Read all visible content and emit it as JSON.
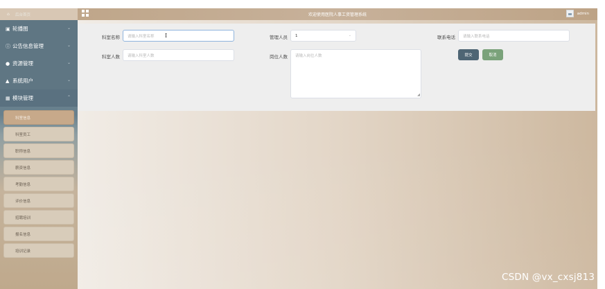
{
  "sidebar": {
    "home": "后台首页",
    "groups": [
      {
        "label": "轮播图",
        "icon": "image-icon"
      },
      {
        "label": "公告信息管理",
        "icon": "info-icon"
      },
      {
        "label": "资源管理",
        "icon": "pin-icon"
      },
      {
        "label": "系统用户",
        "icon": "user-icon"
      },
      {
        "label": "模块管理",
        "icon": "grid-icon"
      }
    ],
    "items": [
      "科室信息",
      "科室员工",
      "职称信息",
      "薪资信息",
      "考勤信息",
      "评价信息",
      "招聘培训",
      "报名信息",
      "培训记录"
    ],
    "active_item": "科室信息"
  },
  "header": {
    "title": "欢迎使用医院人事工资管理系统",
    "user": "admin"
  },
  "form": {
    "dept_name_label": "科室名称",
    "dept_name_placeholder": "请输入科室名称",
    "manager_label": "管理人员",
    "manager_value": "1",
    "phone_label": "联系电话",
    "phone_placeholder": "请输入联系电话",
    "count_label": "科室人数",
    "count_placeholder": "请输入科室人数",
    "positions_label": "岗位人数",
    "positions_placeholder": "请输入岗位人数",
    "submit_label": "提交",
    "cancel_label": "取消"
  },
  "watermark": "CSDN @vx_cxsj813"
}
